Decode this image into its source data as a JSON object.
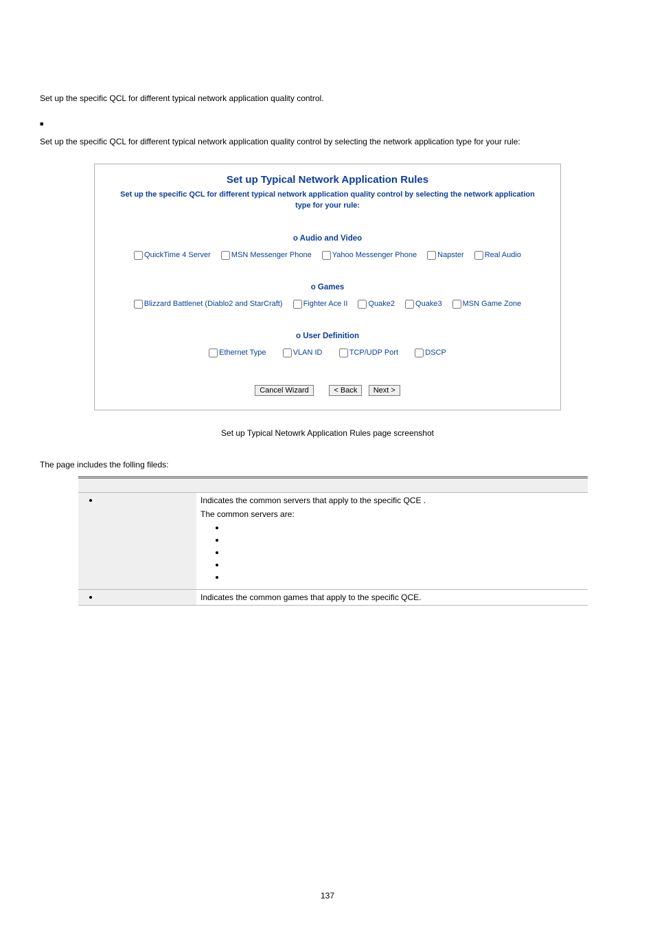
{
  "intro_para": "Set up the specific QCL for different typical network application quality control.",
  "second_para": "Set up the specific QCL for different typical network application quality control by selecting the network application type for your rule:",
  "shot": {
    "title": "Set up Typical Network Application Rules",
    "subtitle": "Set up the specific QCL for different typical network application quality control by selecting the network application type for your rule:",
    "sec_audio": "o Audio and Video",
    "audio_items": [
      "QuickTime 4 Server",
      "MSN Messenger Phone",
      "Yahoo Messenger Phone",
      "Napster",
      "Real Audio"
    ],
    "sec_games": "o Games",
    "games_items": [
      "Blizzard Battlenet (Diablo2 and StarCraft)",
      "Fighter Ace II",
      "Quake2",
      "Quake3",
      "MSN Game Zone"
    ],
    "sec_user": "o User Definition",
    "user_items": [
      "Ethernet Type",
      "VLAN ID",
      "TCP/UDP Port",
      "DSCP"
    ],
    "btn_cancel": "Cancel Wizard",
    "btn_back": "< Back",
    "btn_next": "Next >"
  },
  "caption": "Set up Typical Netowrk Application Rules page screenshot",
  "fields_intro": "The page includes the folling fileds:",
  "row_audio_desc1": "Indicates the common servers that apply to the specific QCE .",
  "row_audio_desc2": "The common servers are:",
  "row_games_desc": "Indicates the common games that apply to the specific QCE.",
  "page_number": "137"
}
